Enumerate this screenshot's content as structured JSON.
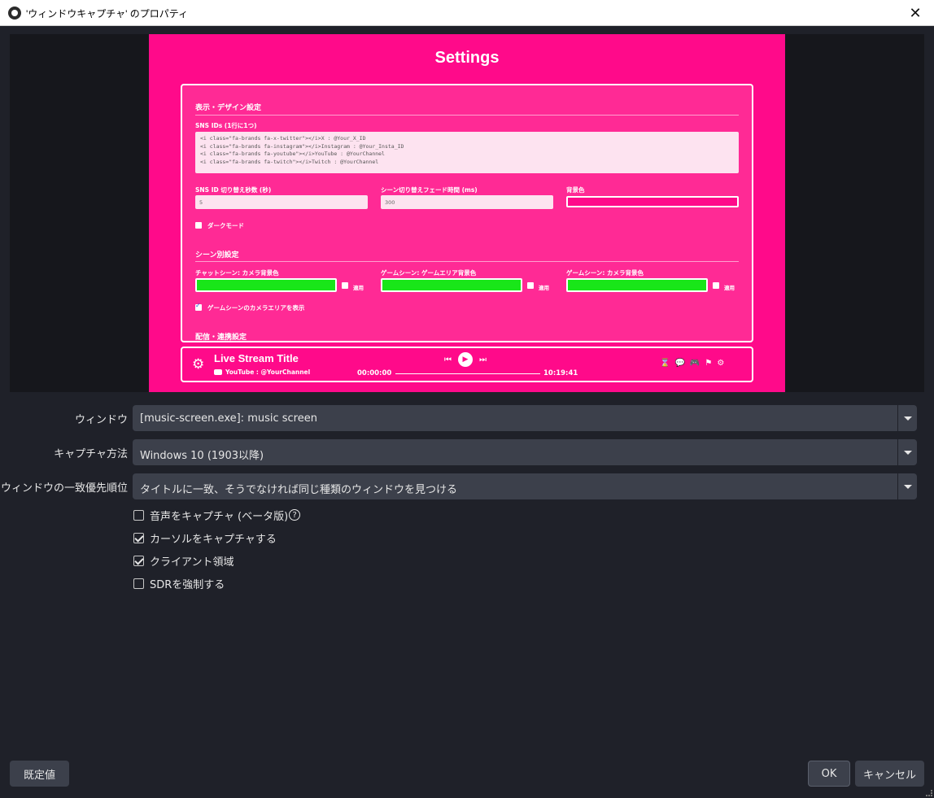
{
  "window": {
    "title": "'ウィンドウキャプチャ' のプロパティ",
    "close_icon": "close-icon"
  },
  "preview": {
    "settings_title": "Settings",
    "section_display": "表示・デザイン設定",
    "sns_ids_label": "SNS IDs (1行に1つ)",
    "sns_ids_lines": [
      "<i class=\"fa-brands fa-x-twitter\"></i>X : @Your_X_ID",
      "<i class=\"fa-brands fa-instagram\"></i>Instagram : @Your_Insta_ID",
      "<i class=\"fa-brands fa-youtube\"></i>YouTube : @YourChannel",
      "<i class=\"fa-brands fa-twitch\"></i>Twitch : @YourChannel"
    ],
    "sns_interval_label": "SNS ID 切り替え秒数 (秒)",
    "sns_interval_value": "5",
    "fade_label": "シーン切り替えフェード時間 (ms)",
    "fade_value": "300",
    "bg_color_label": "背景色",
    "dark_mode_label": "ダークモード",
    "section_scene": "シーン別設定",
    "chat_cam_label": "チャットシーン: カメラ背景色",
    "game_area_label": "ゲームシーン: ゲームエリア背景色",
    "game_cam_label": "ゲームシーン: カメラ背景色",
    "apply_label": "適用",
    "show_cam_label": "ゲームシーンのカメラエリアを表示",
    "section_stream": "配信・連携設定",
    "bg_color": "#ff0a8a",
    "scene_color": "#19e619",
    "player": {
      "stream_title": "Live Stream Title",
      "channel": "YouTube : @YourChannel",
      "time_current": "00:00:00",
      "time_total": "10:19:41"
    }
  },
  "form": {
    "window_label": "ウィンドウ",
    "window_value": "[music-screen.exe]: music screen",
    "capture_method_label": "キャプチャ方法",
    "capture_method_value": "Windows 10 (1903以降)",
    "priority_label": "ウィンドウの一致優先順位",
    "priority_value": "タイトルに一致、そうでなければ同じ種類のウィンドウを見つける",
    "checkboxes": [
      {
        "label": "音声をキャプチャ (ベータ版)",
        "checked": false
      },
      {
        "label": "カーソルをキャプチャする",
        "checked": true
      },
      {
        "label": "クライアント領域",
        "checked": true
      },
      {
        "label": "SDRを強制する",
        "checked": false
      }
    ]
  },
  "buttons": {
    "defaults": "既定値",
    "ok": "OK",
    "cancel": "キャンセル"
  }
}
